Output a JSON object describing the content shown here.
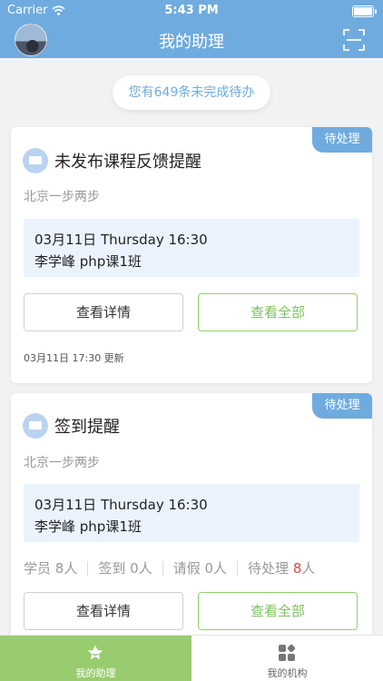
{
  "status_bar": {
    "carrier": "Carrier",
    "time": "5:43 PM"
  },
  "header": {
    "title": "我的助理"
  },
  "pending_banner": "您有649条未完成待办",
  "cards": [
    {
      "tag": "待处理",
      "title": "未发布课程反馈提醒",
      "org": "北京一步两步",
      "datetime": "03月11日 Thursday 16:30",
      "class_info": "李学峰  php课1班",
      "detail_label": "查看详情",
      "all_label": "查看全部",
      "updated": "03月11日 17:30  更新"
    },
    {
      "tag": "待处理",
      "title": "签到提醒",
      "org": "北京一步两步",
      "datetime": "03月11日 Thursday 16:30",
      "class_info": "李学峰  php课1班",
      "stats": {
        "students_label": "学员",
        "students": "8人",
        "signed_label": "签到",
        "signed": "0人",
        "leave_label": "请假",
        "leave": "0人",
        "pending_label": "待处理",
        "pending_num": "8",
        "pending_unit": "人"
      },
      "detail_label": "查看详情",
      "all_label": "查看全部"
    }
  ],
  "tabbar": [
    {
      "label": "我的助理",
      "icon": "star-icon",
      "active": true
    },
    {
      "label": "我的机构",
      "icon": "grid-icon",
      "active": false
    }
  ],
  "colors": {
    "header": "#6fabdf",
    "tab_active": "#98cc6e",
    "accent_green": "#7cc35c",
    "alert_red": "#e64545"
  }
}
